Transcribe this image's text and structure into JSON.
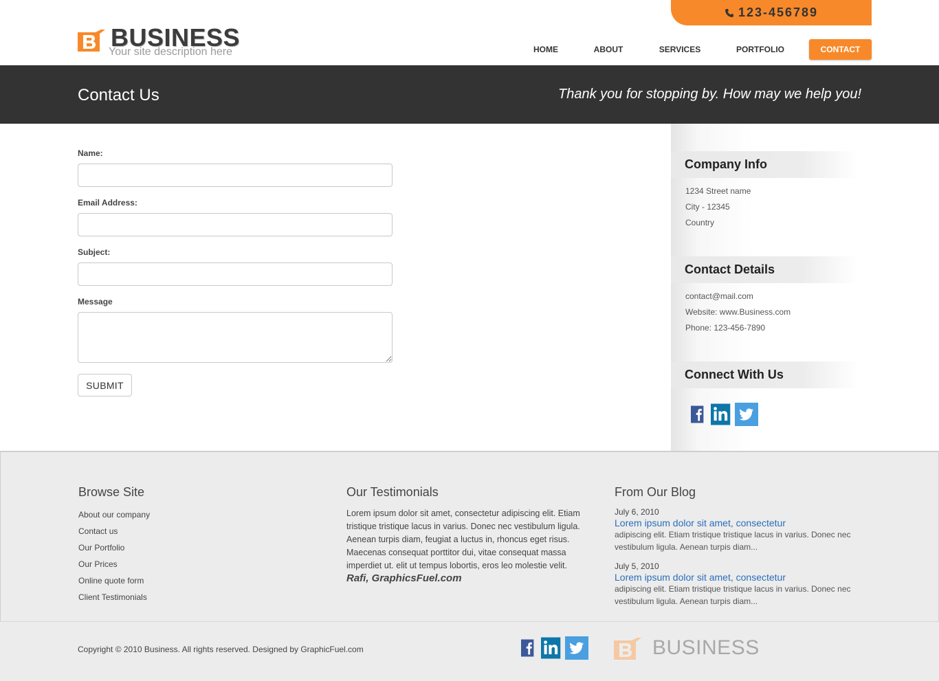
{
  "header": {
    "phone": "123-456789",
    "logo_title": "BUSINESS",
    "logo_subtitle": "Your site description here",
    "nav": [
      {
        "label": "HOME",
        "active": false
      },
      {
        "label": "ABOUT",
        "active": false
      },
      {
        "label": "SERVICES",
        "active": false
      },
      {
        "label": "PORTFOLIO",
        "active": false
      },
      {
        "label": "CONTACT",
        "active": true
      }
    ]
  },
  "banner": {
    "title": "Contact Us",
    "tagline": "Thank you for stopping by. How may we help you!"
  },
  "form": {
    "name_label": "Name:",
    "email_label": "Email Address:",
    "subject_label": "Subject:",
    "message_label": "Message",
    "name_value": "",
    "email_value": "",
    "subject_value": "",
    "message_value": "",
    "submit_label": "SUBMIT"
  },
  "sidebar": {
    "company_info": {
      "title": "Company Info",
      "lines": [
        "1234 Street name",
        "City - 12345",
        "Country"
      ]
    },
    "contact_details": {
      "title": "Contact Details",
      "lines": [
        "contact@mail.com",
        "Website: www.Business.com",
        "Phone: 123-456-7890"
      ]
    },
    "connect": {
      "title": "Connect With Us",
      "icons": [
        "facebook-icon",
        "linkedin-icon",
        "twitter-icon"
      ]
    }
  },
  "footer": {
    "browse": {
      "title": "Browse Site",
      "links": [
        "About our company",
        "Contact us",
        "Our Portfolio",
        "Our Prices",
        "Online quote form",
        "Client Testimonials"
      ]
    },
    "testimonials": {
      "title": "Our Testimonials",
      "text": "Lorem ipsum dolor sit amet, consectetur adipiscing elit. Etiam tristique tristique lacus in varius. Donec nec vestibulum ligula. Aenean turpis diam, feugiat a luctus in, rhoncus eget risus. Maecenas consequat porttitor dui, vitae consequat massa imperdiet ut. elit ut tempus lobortis, eros leo molestie velit.",
      "author": "Rafi, GraphicsFuel.com"
    },
    "blog": {
      "title": "From Our Blog",
      "posts": [
        {
          "date": "July 6, 2010",
          "title": "Lorem ipsum dolor sit amet, consectetur",
          "excerpt": "adipiscing elit. Etiam tristique tristique lacus in varius. Donec nec vestibulum ligula. Aenean turpis diam..."
        },
        {
          "date": "July 5, 2010",
          "title": "Lorem ipsum dolor sit amet, consectetur",
          "excerpt": "adipiscing elit. Etiam tristique tristique lacus in varius. Donec nec vestibulum ligula. Aenean turpis diam..."
        }
      ]
    },
    "copyright": "Copyright © 2010 Business. All rights reserved. Designed by GraphicFuel.com",
    "logo_title": "BUSINESS"
  },
  "colors": {
    "accent": "#f7892a",
    "banner": "#333333",
    "footer": "#ececec",
    "link": "#2a6ebb",
    "facebook": "#3b5998",
    "linkedin": "#0e76a8",
    "twitter": "#4a9fe0"
  }
}
